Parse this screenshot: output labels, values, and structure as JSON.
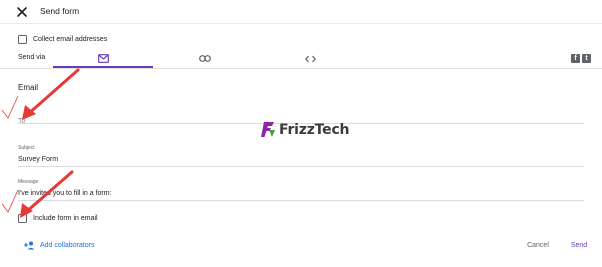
{
  "header": {
    "title": "Send form"
  },
  "options": {
    "collect_email_label": "Collect email addresses"
  },
  "send_via": {
    "label": "Send via",
    "active_tab": "email",
    "tabs": [
      {
        "name": "email",
        "icon": "mail-icon"
      },
      {
        "name": "link",
        "icon": "link-icon"
      },
      {
        "name": "embed",
        "icon": "code-icon"
      }
    ],
    "social": [
      {
        "name": "facebook",
        "icon": "facebook-icon",
        "glyph": "f"
      },
      {
        "name": "twitter",
        "icon": "twitter-icon",
        "glyph": "t"
      }
    ]
  },
  "email_section": {
    "title": "Email",
    "to": {
      "placeholder": "To",
      "value": ""
    },
    "subject": {
      "label": "Subject",
      "value": "Survey Form"
    },
    "message": {
      "label": "Message",
      "value": "I've invited you to fill in a form:"
    },
    "include_form_label": "Include form in email"
  },
  "footer": {
    "add_collaborators": "Add collaborators",
    "cancel": "Cancel",
    "send": "Send"
  },
  "watermark": {
    "text": "FrizzTech"
  },
  "colors": {
    "accent": "#673ab7",
    "link": "#1a73e8",
    "annotation_red": "#e53935"
  }
}
